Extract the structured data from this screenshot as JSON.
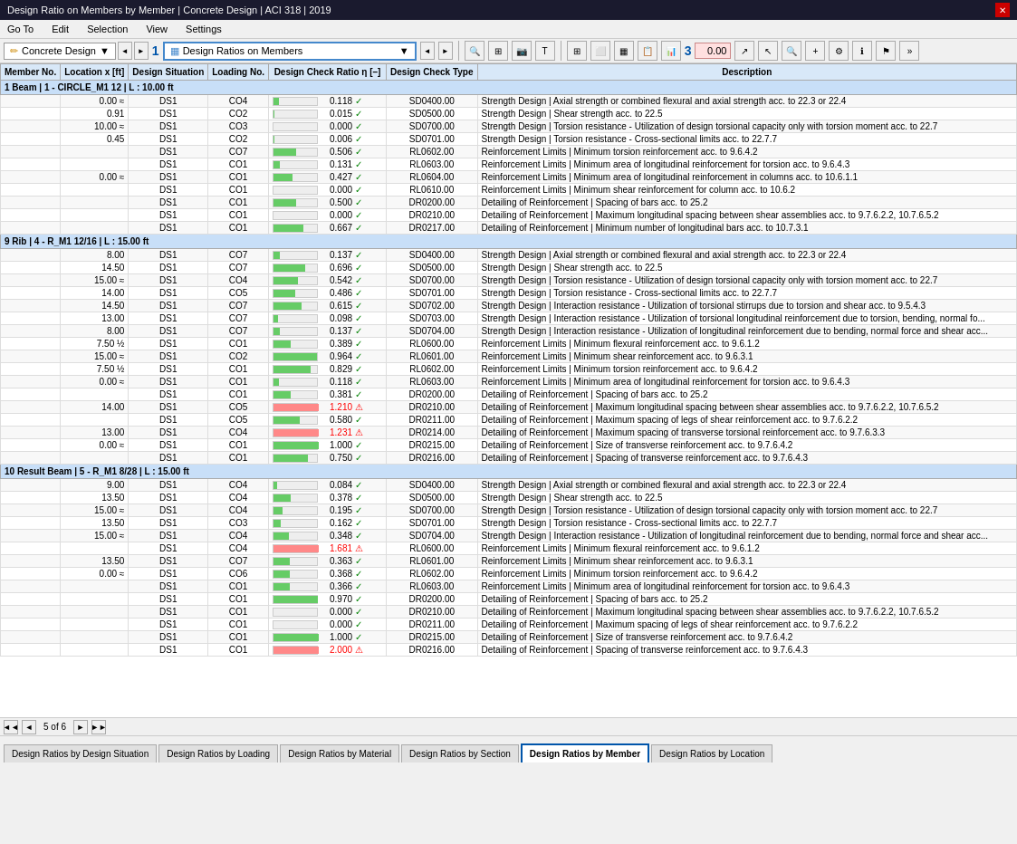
{
  "titleBar": {
    "title": "Design Ratio on Members by Member | Concrete Design | ACI 318 | 2019",
    "closeLabel": "✕"
  },
  "menuBar": {
    "items": [
      "Go To",
      "Edit",
      "Selection",
      "View",
      "Settings"
    ]
  },
  "toolbar": {
    "badge1": "1",
    "badge2": "",
    "badge3": "3",
    "concreteDesign": "Concrete Design",
    "dropdownLabel": "Design Ratios on Members",
    "numberValue": "0.00"
  },
  "tableHeaders": {
    "memberNo": "Member No.",
    "locationX": "Location x [ft]",
    "designSituation": "Design Situation",
    "loadingNo": "Loading No.",
    "designCheckRatio": "Design Check Ratio η [–]",
    "designCheckType": "Design Check Type",
    "description": "Description"
  },
  "groups": [
    {
      "id": "group1",
      "header": "1    Beam | 1 - CIRCLE_M1 12 | L : 10.00 ft",
      "rows": [
        {
          "loc": "0.00 ≈",
          "sit": "DS1",
          "load": "CO4",
          "ratio": 0.118,
          "checkType": "SD0400.00",
          "checkMark": "✓",
          "ratioExceed": false,
          "desc": "Strength Design | Axial strength or combined flexural and axial strength acc. to 22.3 or 22.4"
        },
        {
          "loc": "0.91",
          "sit": "DS1",
          "load": "CO2",
          "ratio": 0.015,
          "checkType": "SD0500.00",
          "checkMark": "✓",
          "ratioExceed": false,
          "desc": "Strength Design | Shear strength acc. to 22.5"
        },
        {
          "loc": "10.00 ≈",
          "sit": "DS1",
          "load": "CO3",
          "ratio": 0.0,
          "checkType": "SD0700.00",
          "checkMark": "✓",
          "ratioExceed": false,
          "desc": "Strength Design | Torsion resistance - Utilization of design torsional capacity only with torsion moment acc. to 22.7"
        },
        {
          "loc": "0.45",
          "sit": "DS1",
          "load": "CO2",
          "ratio": 0.006,
          "checkType": "SD0701.00",
          "checkMark": "✓",
          "ratioExceed": false,
          "desc": "Strength Design | Torsion resistance - Cross-sectional limits acc. to 22.7.7"
        },
        {
          "loc": "",
          "sit": "DS1",
          "load": "CO7",
          "ratio": 0.506,
          "checkType": "RL0602.00",
          "checkMark": "✓",
          "ratioExceed": false,
          "desc": "Reinforcement Limits | Minimum torsion reinforcement acc. to 9.6.4.2"
        },
        {
          "loc": "",
          "sit": "DS1",
          "load": "CO1",
          "ratio": 0.131,
          "checkType": "RL0603.00",
          "checkMark": "✓",
          "ratioExceed": false,
          "desc": "Reinforcement Limits | Minimum area of longitudinal reinforcement for torsion acc. to 9.6.4.3"
        },
        {
          "loc": "0.00 ≈",
          "sit": "DS1",
          "load": "CO1",
          "ratio": 0.427,
          "checkType": "RL0604.00",
          "checkMark": "✓",
          "ratioExceed": false,
          "desc": "Reinforcement Limits | Minimum area of longitudinal reinforcement in columns acc. to 10.6.1.1"
        },
        {
          "loc": "",
          "sit": "DS1",
          "load": "CO1",
          "ratio": 0.0,
          "checkType": "RL0610.00",
          "checkMark": "✓",
          "ratioExceed": false,
          "desc": "Reinforcement Limits | Minimum shear reinforcement for column acc. to 10.6.2"
        },
        {
          "loc": "",
          "sit": "DS1",
          "load": "CO1",
          "ratio": 0.5,
          "checkType": "DR0200.00",
          "checkMark": "✓",
          "ratioExceed": false,
          "desc": "Detailing of Reinforcement | Spacing of bars acc. to 25.2"
        },
        {
          "loc": "",
          "sit": "DS1",
          "load": "CO1",
          "ratio": 0.0,
          "checkType": "DR0210.00",
          "checkMark": "✓",
          "ratioExceed": false,
          "desc": "Detailing of Reinforcement | Maximum longitudinal spacing between shear assemblies acc. to 9.7.6.2.2, 10.7.6.5.2"
        },
        {
          "loc": "",
          "sit": "DS1",
          "load": "CO1",
          "ratio": 0.667,
          "checkType": "DR0217.00",
          "checkMark": "✓",
          "ratioExceed": false,
          "desc": "Detailing of Reinforcement | Minimum number of longitudinal bars acc. to 10.7.3.1"
        }
      ]
    },
    {
      "id": "group9",
      "header": "9    Rib | 4 - R_M1 12/16 | L : 15.00 ft",
      "rows": [
        {
          "loc": "8.00",
          "sit": "DS1",
          "load": "CO7",
          "ratio": 0.137,
          "checkType": "SD0400.00",
          "checkMark": "✓",
          "ratioExceed": false,
          "desc": "Strength Design | Axial strength or combined flexural and axial strength acc. to 22.3 or 22.4"
        },
        {
          "loc": "14.50",
          "sit": "DS1",
          "load": "CO7",
          "ratio": 0.696,
          "checkType": "SD0500.00",
          "checkMark": "✓",
          "ratioExceed": false,
          "desc": "Strength Design | Shear strength acc. to 22.5"
        },
        {
          "loc": "15.00 ≈",
          "sit": "DS1",
          "load": "CO4",
          "ratio": 0.542,
          "checkType": "SD0700.00",
          "checkMark": "✓",
          "ratioExceed": false,
          "desc": "Strength Design | Torsion resistance - Utilization of design torsional capacity only with torsion moment acc. to 22.7"
        },
        {
          "loc": "14.00",
          "sit": "DS1",
          "load": "CO5",
          "ratio": 0.486,
          "checkType": "SD0701.00",
          "checkMark": "✓",
          "ratioExceed": false,
          "desc": "Strength Design | Torsion resistance - Cross-sectional limits acc. to 22.7.7"
        },
        {
          "loc": "14.50",
          "sit": "DS1",
          "load": "CO7",
          "ratio": 0.615,
          "checkType": "SD0702.00",
          "checkMark": "✓",
          "ratioExceed": false,
          "desc": "Strength Design | Interaction resistance - Utilization of torsional stirrups due to torsion and shear acc. to 9.5.4.3"
        },
        {
          "loc": "13.00",
          "sit": "DS1",
          "load": "CO7",
          "ratio": 0.098,
          "checkType": "SD0703.00",
          "checkMark": "✓",
          "ratioExceed": false,
          "desc": "Strength Design | Interaction resistance - Utilization of torsional longitudinal reinforcement due to torsion, bending, normal fo..."
        },
        {
          "loc": "8.00",
          "sit": "DS1",
          "load": "CO7",
          "ratio": 0.137,
          "checkType": "SD0704.00",
          "checkMark": "✓",
          "ratioExceed": false,
          "desc": "Strength Design | Interaction resistance - Utilization of longitudinal reinforcement due to bending, normal force and shear acc..."
        },
        {
          "loc": "7.50 ½",
          "sit": "DS1",
          "load": "CO1",
          "ratio": 0.389,
          "checkType": "RL0600.00",
          "checkMark": "✓",
          "ratioExceed": false,
          "desc": "Reinforcement Limits | Minimum flexural reinforcement acc. to 9.6.1.2"
        },
        {
          "loc": "15.00 ≈",
          "sit": "DS1",
          "load": "CO2",
          "ratio": 0.964,
          "checkType": "RL0601.00",
          "checkMark": "✓",
          "ratioExceed": false,
          "desc": "Reinforcement Limits | Minimum shear reinforcement acc. to 9.6.3.1"
        },
        {
          "loc": "7.50 ½",
          "sit": "DS1",
          "load": "CO1",
          "ratio": 0.829,
          "checkType": "RL0602.00",
          "checkMark": "✓",
          "ratioExceed": false,
          "desc": "Reinforcement Limits | Minimum torsion reinforcement acc. to 9.6.4.2"
        },
        {
          "loc": "0.00 ≈",
          "sit": "DS1",
          "load": "CO1",
          "ratio": 0.118,
          "checkType": "RL0603.00",
          "checkMark": "✓",
          "ratioExceed": false,
          "desc": "Reinforcement Limits | Minimum area of longitudinal reinforcement for torsion acc. to 9.6.4.3"
        },
        {
          "loc": "",
          "sit": "DS1",
          "load": "CO1",
          "ratio": 0.381,
          "checkType": "DR0200.00",
          "checkMark": "✓",
          "ratioExceed": false,
          "desc": "Detailing of Reinforcement | Spacing of bars acc. to 25.2"
        },
        {
          "loc": "14.00",
          "sit": "DS1",
          "load": "CO5",
          "ratio": 1.21,
          "checkType": "DR0210.00",
          "checkMark": "!",
          "ratioExceed": true,
          "desc": "Detailing of Reinforcement | Maximum longitudinal spacing between shear assemblies acc. to 9.7.6.2.2, 10.7.6.5.2"
        },
        {
          "loc": "",
          "sit": "DS1",
          "load": "CO5",
          "ratio": 0.58,
          "checkType": "DR0211.00",
          "checkMark": "✓",
          "ratioExceed": false,
          "desc": "Detailing of Reinforcement | Maximum spacing of legs of shear reinforcement acc. to 9.7.6.2.2"
        },
        {
          "loc": "13.00",
          "sit": "DS1",
          "load": "CO4",
          "ratio": 1.231,
          "checkType": "DR0214.00",
          "checkMark": "!",
          "ratioExceed": true,
          "desc": "Detailing of Reinforcement | Maximum spacing of transverse torsional reinforcement acc. to 9.7.6.3.3"
        },
        {
          "loc": "0.00 ≈",
          "sit": "DS1",
          "load": "CO1",
          "ratio": 1.0,
          "checkType": "DR0215.00",
          "checkMark": "✓",
          "ratioExceed": false,
          "desc": "Detailing of Reinforcement | Size of transverse reinforcement acc. to 9.7.6.4.2"
        },
        {
          "loc": "",
          "sit": "DS1",
          "load": "CO1",
          "ratio": 0.75,
          "checkType": "DR0216.00",
          "checkMark": "✓",
          "ratioExceed": false,
          "desc": "Detailing of Reinforcement | Spacing of transverse reinforcement acc. to 9.7.6.4.3"
        }
      ]
    },
    {
      "id": "group10",
      "header": "10   Result Beam | 5 - R_M1 8/28 | L : 15.00 ft",
      "rows": [
        {
          "loc": "9.00",
          "sit": "DS1",
          "load": "CO4",
          "ratio": 0.084,
          "checkType": "SD0400.00",
          "checkMark": "✓",
          "ratioExceed": false,
          "desc": "Strength Design | Axial strength or combined flexural and axial strength acc. to 22.3 or 22.4"
        },
        {
          "loc": "13.50",
          "sit": "DS1",
          "load": "CO4",
          "ratio": 0.378,
          "checkType": "SD0500.00",
          "checkMark": "✓",
          "ratioExceed": false,
          "desc": "Strength Design | Shear strength acc. to 22.5"
        },
        {
          "loc": "15.00 ≈",
          "sit": "DS1",
          "load": "CO4",
          "ratio": 0.195,
          "checkType": "SD0700.00",
          "checkMark": "✓",
          "ratioExceed": false,
          "desc": "Strength Design | Torsion resistance - Utilization of design torsional capacity only with torsion moment acc. to 22.7"
        },
        {
          "loc": "13.50",
          "sit": "DS1",
          "load": "CO3",
          "ratio": 0.162,
          "checkType": "SD0701.00",
          "checkMark": "✓",
          "ratioExceed": false,
          "desc": "Strength Design | Torsion resistance - Cross-sectional limits acc. to 22.7.7"
        },
        {
          "loc": "15.00 ≈",
          "sit": "DS1",
          "load": "CO4",
          "ratio": 0.348,
          "checkType": "SD0704.00",
          "checkMark": "✓",
          "ratioExceed": false,
          "desc": "Strength Design | Interaction resistance - Utilization of longitudinal reinforcement due to bending, normal force and shear acc..."
        },
        {
          "loc": "",
          "sit": "DS1",
          "load": "CO4",
          "ratio": 1.681,
          "checkType": "RL0600.00",
          "checkMark": "!",
          "ratioExceed": true,
          "desc": "Reinforcement Limits | Minimum flexural reinforcement acc. to 9.6.1.2"
        },
        {
          "loc": "13.50",
          "sit": "DS1",
          "load": "CO7",
          "ratio": 0.363,
          "checkType": "RL0601.00",
          "checkMark": "✓",
          "ratioExceed": false,
          "desc": "Reinforcement Limits | Minimum shear reinforcement acc. to 9.6.3.1"
        },
        {
          "loc": "0.00 ≈",
          "sit": "DS1",
          "load": "CO6",
          "ratio": 0.368,
          "checkType": "RL0602.00",
          "checkMark": "✓",
          "ratioExceed": false,
          "desc": "Reinforcement Limits | Minimum torsion reinforcement acc. to 9.6.4.2"
        },
        {
          "loc": "",
          "sit": "DS1",
          "load": "CO1",
          "ratio": 0.366,
          "checkType": "RL0603.00",
          "checkMark": "✓",
          "ratioExceed": false,
          "desc": "Reinforcement Limits | Minimum area of longitudinal reinforcement for torsion acc. to 9.6.4.3"
        },
        {
          "loc": "",
          "sit": "DS1",
          "load": "CO1",
          "ratio": 0.97,
          "checkType": "DR0200.00",
          "checkMark": "✓",
          "ratioExceed": false,
          "desc": "Detailing of Reinforcement | Spacing of bars acc. to 25.2"
        },
        {
          "loc": "",
          "sit": "DS1",
          "load": "CO1",
          "ratio": 0.0,
          "checkType": "DR0210.00",
          "checkMark": "✓",
          "ratioExceed": false,
          "desc": "Detailing of Reinforcement | Maximum longitudinal spacing between shear assemblies acc. to 9.7.6.2.2, 10.7.6.5.2"
        },
        {
          "loc": "",
          "sit": "DS1",
          "load": "CO1",
          "ratio": 0.0,
          "checkType": "DR0211.00",
          "checkMark": "✓",
          "ratioExceed": false,
          "desc": "Detailing of Reinforcement | Maximum spacing of legs of shear reinforcement acc. to 9.7.6.2.2"
        },
        {
          "loc": "",
          "sit": "DS1",
          "load": "CO1",
          "ratio": 1.0,
          "checkType": "DR0215.00",
          "checkMark": "✓",
          "ratioExceed": false,
          "desc": "Detailing of Reinforcement | Size of transverse reinforcement acc. to 9.7.6.4.2"
        },
        {
          "loc": "",
          "sit": "DS1",
          "load": "CO1",
          "ratio": 2.0,
          "checkType": "DR0216.00",
          "checkMark": "!",
          "ratioExceed": true,
          "desc": "Detailing of Reinforcement | Spacing of transverse reinforcement acc. to 9.7.6.4.3"
        }
      ]
    }
  ],
  "statusBar": {
    "pageOf": "5 of 6",
    "scrollArrow": "◄"
  },
  "tabs": [
    {
      "id": "tab1",
      "label": "Design Ratios by Design Situation",
      "active": false
    },
    {
      "id": "tab2",
      "label": "Design Ratios by Loading",
      "active": false
    },
    {
      "id": "tab3",
      "label": "Design Ratios by Material",
      "active": false
    },
    {
      "id": "tab4",
      "label": "Design Ratios by Section",
      "active": false
    },
    {
      "id": "tab5",
      "label": "Design Ratios by Member",
      "active": true
    },
    {
      "id": "tab6",
      "label": "Design Ratios by Location",
      "active": false
    }
  ]
}
